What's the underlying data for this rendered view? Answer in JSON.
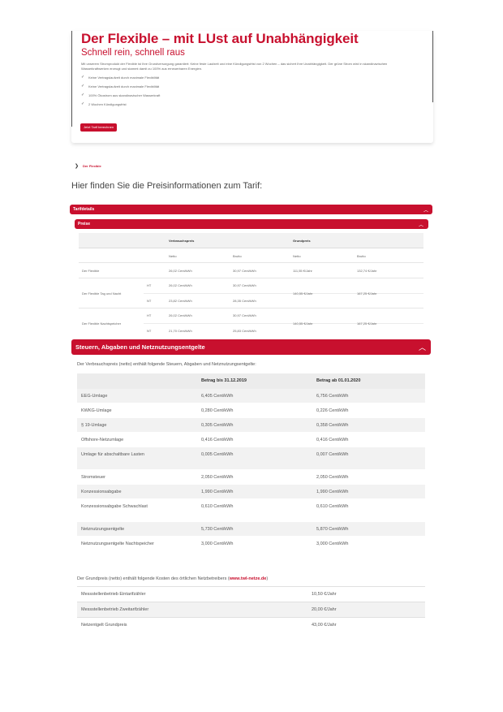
{
  "hero": {
    "title": "Der Flexible – mit LUst auf Unabhängigkeit",
    "subtitle": "Schnell rein, schnell raus",
    "description": "Mit unserem Stromprodukt der Flexible ist Ihre Grundversorgung garantiert: Keine feste Laufzeit und eine Kündigungsfrist von 2 Wochen – das sichert Ihre Unabhängigkeit. Der grüne Strom wird in skandinavischen Wasserkraftwerken erzeugt und stammt damit zu 100% aus erneuerbaren Energien.",
    "features": [
      "Keine Vertragslaufzeit durch maximale Flexibilität",
      "Keine Vertragslaufzeit durch maximale Flexibilität",
      "100% Ökostrom aus skandinavischer Wasserkraft",
      "2 Wochen Kündigungsfrist"
    ],
    "cta_label": "Jetzt Tarif berechnen"
  },
  "breadcrumb": {
    "current": "Der Flexible"
  },
  "section_heading": "Hier finden Sie die Preisinformationen zum Tarif:",
  "accordions": {
    "tarifdetails": "Tarifdetails",
    "preise": "Preise",
    "steuern": "Steuern, Abgaben und Netznutzungsentgelte"
  },
  "price_table": {
    "group_headers": [
      "Verbrauchspreis",
      "Grundpreis"
    ],
    "sub_headers": [
      "Netto",
      "Brutto",
      "Netto",
      "Brutto"
    ],
    "rows": [
      {
        "name": "Der Flexible",
        "tariffs": [
          {
            "zone": "",
            "vnetto": "26,02 Cent/kWh",
            "vbrutto": "30,97 Cent/kWh"
          }
        ],
        "gnetto": "111,55 €/Jahr",
        "gbrutto": "132,74 €/Jahr"
      },
      {
        "name": "Der Flexible Tag und Nacht",
        "tariffs": [
          {
            "zone": "HT",
            "vnetto": "26,02 Cent/kWh",
            "vbrutto": "30,97 Cent/kWh"
          },
          {
            "zone": "NT",
            "vnetto": "23,82 Cent/kWh",
            "vbrutto": "28,35 Cent/kWh"
          }
        ],
        "gnetto": "140,55 €/Jahr",
        "gbrutto": "167,25 €/Jahr"
      },
      {
        "name": "Der Flexible Nachtspeicher",
        "tariffs": [
          {
            "zone": "HT",
            "vnetto": "26,02 Cent/kWh",
            "vbrutto": "30,97 Cent/kWh"
          },
          {
            "zone": "NT",
            "vnetto": "21,70 Cent/kWh",
            "vbrutto": "25,83 Cent/kWh"
          }
        ],
        "gnetto": "140,55 €/Jahr",
        "gbrutto": "167,25 €/Jahr"
      }
    ]
  },
  "tax_section": {
    "intro": "Der Verbrauchspreis (netto) enthält folgende Steuern, Abgaben und Netznutzungsentgelte:",
    "headers": [
      "",
      "Betrag bis 31.12.2019",
      "Betrag ab 01.01.2020"
    ],
    "rows": [
      {
        "name": "EEG-Umlage",
        "a": "6,405 Cent/kWh",
        "b": "6,756 Cent/kWh"
      },
      {
        "name": "KWKG-Umlage",
        "a": "0,280 Cent/kWh",
        "b": "0,226 Cent/kWh"
      },
      {
        "name": "§ 19-Umlage",
        "a": "0,305 Cent/kWh",
        "b": "0,358 Cent/kWh"
      },
      {
        "name": "Offshore-Netzumlage",
        "a": "0,416 Cent/kWh",
        "b": "0,416 Cent/kWh"
      },
      {
        "name": "Umlage für abschaltbare Lasten",
        "a": "0,005 Cent/kWh",
        "b": "0,007 Cent/kWh"
      },
      {
        "name": "Stromsteuer",
        "a": "2,050 Cent/kWh",
        "b": "2,050 Cent/kWh"
      },
      {
        "name": "Konzessionsabgabe",
        "a": "1,990 Cent/kWh",
        "b": "1,990 Cent/kWh"
      },
      {
        "name": "Konzessionsabgabe Schwachlast",
        "a": "0,610 Cent/kWh",
        "b": "0,610 Cent/kWh"
      },
      {
        "name": "Netznutzungsentgelte",
        "a": "5,730 Cent/kWh",
        "b": "5,870 Cent/kWh"
      },
      {
        "name": "Netznutzungsentgelte Nachtspeicher",
        "a": "3,000 Cent/kWh",
        "b": "3,000 Cent/kWh"
      }
    ]
  },
  "grund_section": {
    "intro_prefix": "Der Grundpreis (netto) enthält folgende Kosten des örtlichen Netzbetreibers (",
    "link": "www.twl-netze.de",
    "intro_suffix": ")",
    "rows": [
      {
        "name": "Messstellenbetrieb Eintarifzähler",
        "value": "10,50 €/Jahr"
      },
      {
        "name": "Messstellenbetrieb Zweitarifzähler",
        "value": "20,00 €/Jahr"
      },
      {
        "name": "Netzentgelt Grundpreis",
        "value": "43,00 €/Jahr"
      }
    ]
  },
  "icons": {
    "check": "check-icon",
    "chevron": "chevron-right-icon",
    "caret": "caret-up-icon"
  },
  "colors": {
    "brand": "#c8102e",
    "row_shade": "#f2f2f2"
  }
}
